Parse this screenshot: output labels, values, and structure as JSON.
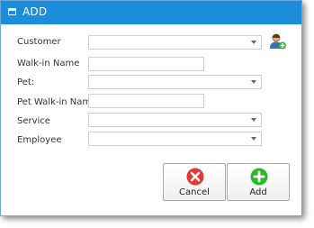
{
  "window": {
    "title": "ADD",
    "icon": "window-icon"
  },
  "form": {
    "customer": {
      "label": "Customer",
      "value": ""
    },
    "walkin_name": {
      "label": "Walk-in Name",
      "value": ""
    },
    "pet": {
      "label": "Pet:",
      "value": ""
    },
    "pet_walkin_name": {
      "label": "Pet Walk-in Name",
      "value": ""
    },
    "service": {
      "label": "Service",
      "value": ""
    },
    "employee": {
      "label": "Employee",
      "value": ""
    }
  },
  "buttons": {
    "cancel": {
      "label": "Cancel",
      "icon": "cancel-x-icon",
      "color": "#e53935"
    },
    "add": {
      "label": "Add",
      "icon": "plus-circle-icon",
      "color": "#2eb82e"
    }
  },
  "icons": {
    "add_customer": "add-person-icon"
  },
  "colors": {
    "titlebar": "#1a8ddb",
    "field_border": "#cfcfcf"
  }
}
